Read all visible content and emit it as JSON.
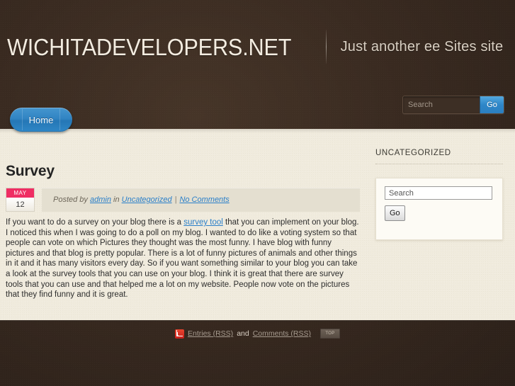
{
  "header": {
    "site_title": "WICHITADEVELOPERS.NET",
    "tagline": "Just another ee Sites site",
    "search": {
      "placeholder": "Search",
      "value": "",
      "go_label": "Go"
    }
  },
  "nav": {
    "items": [
      {
        "label": "Home",
        "active": true
      }
    ]
  },
  "post": {
    "title": "Survey",
    "date": {
      "month": "MAY",
      "day": "12"
    },
    "meta": {
      "posted_by_label": "Posted by",
      "author": "admin",
      "in_label": "in",
      "category": "Uncategorized",
      "separator": "|",
      "comments": "No Comments"
    },
    "body": {
      "part1": "If you want to do a survey on your blog there is a ",
      "link": "survey tool",
      "part2": " that you can implement on your blog. I noticed this when I was going to do a poll on my blog. I wanted to do like a voting system so that people can vote on which Pictures they thought was the most funny. I have blog with funny pictures and that blog is pretty popular. There is a lot of funny pictures of animals and other things in it and it has many visitors every day. So if you want something similar to your blog you can take a look at the survey tools that you can use on your blog. I think it is great that there are survey tools that you can use and that helped me a lot on my website. People now vote on the pictures that they find funny and it is great."
    }
  },
  "sidebar": {
    "widget_title": "UNCATEGORIZED",
    "search": {
      "placeholder": "Search",
      "value": "",
      "go_label": "Go"
    }
  },
  "footer": {
    "entries_label": "Entries (RSS)",
    "and_label": "and",
    "comments_label": "Comments (RSS)",
    "top_label": "TOP"
  },
  "colors": {
    "header_bg": "#3a2b21",
    "content_bg": "#f0ebdd",
    "accent_blue": "#2f86c6",
    "date_badge_pink": "#ef2e63",
    "link_blue": "#2a7fc9",
    "rss_red": "#c9201c"
  }
}
